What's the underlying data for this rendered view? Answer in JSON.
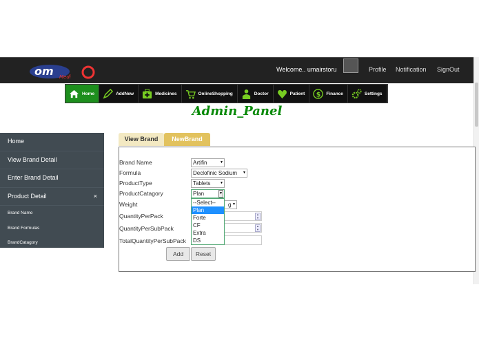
{
  "header": {
    "welcome": "Welcome.. umairstoru",
    "links": [
      "Profile",
      "Notification",
      "SignOut"
    ],
    "logo_text": "Om Medi"
  },
  "nav": {
    "items": [
      {
        "label": "Home",
        "icon": "home-icon"
      },
      {
        "label": "AddNew",
        "icon": "pencil-icon"
      },
      {
        "label": "Medicines",
        "icon": "medkit-icon"
      },
      {
        "label": "OnlineShopping",
        "icon": "cart-icon"
      },
      {
        "label": "Doctor",
        "icon": "doctor-icon"
      },
      {
        "label": "Patient",
        "icon": "heart-icon"
      },
      {
        "label": "Finance",
        "icon": "dollar-icon"
      },
      {
        "label": "Settings",
        "icon": "gear-icon"
      }
    ],
    "active_color": "#1d8f1d"
  },
  "title": "Admin_Panel",
  "sidebar": {
    "items": [
      "Home",
      "View Brand Detail",
      "Enter Brand Detail",
      "Product Detail"
    ],
    "close": "×",
    "subitems": [
      "Brand Name",
      "Brand Formulas",
      "BrandCatagory"
    ]
  },
  "tabs": [
    "View Brand",
    "NewBrand"
  ],
  "form": {
    "labels": [
      "Brand Name",
      "Formula",
      "ProductType",
      "ProductCatagory",
      "Weight",
      "QuantityPerPack",
      "QuantityPerSubPack",
      "TotalQuantityPerSubPack"
    ],
    "brand_name": "Artifin",
    "formula": "Declofinic Sodium",
    "product_type": "Tablets",
    "product_category": "Plan",
    "weight_visible": "g",
    "category_options": [
      "--Select--",
      "Plan",
      "Forte",
      "CF",
      "Extra",
      "DS"
    ],
    "category_highlighted": "Plan",
    "spin_up": "▲",
    "spin_down": "▼"
  },
  "buttons": {
    "add": "Add",
    "reset": "Reset"
  }
}
